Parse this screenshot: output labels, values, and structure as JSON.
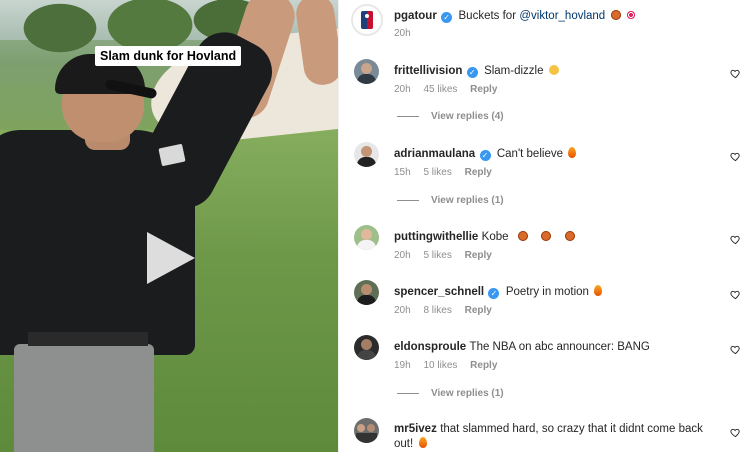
{
  "video": {
    "caption": "Slam dunk for Hovland"
  },
  "post": {
    "username": "pgatour",
    "caption_prefix": "Buckets for",
    "mention": "@viktor_hovland",
    "emojis": [
      "basketball",
      "bullseye"
    ],
    "time": "20h"
  },
  "comments": [
    {
      "username": "frittellivision",
      "verified": true,
      "text": "Slam-dizzle",
      "emojis": [
        "laughing-face"
      ],
      "time": "20h",
      "likes": "45 likes",
      "reply": "Reply",
      "view_replies": "View replies (4)"
    },
    {
      "username": "adrianmaulana",
      "verified": true,
      "text": "Can't believe",
      "emojis": [
        "fire"
      ],
      "time": "15h",
      "likes": "5 likes",
      "reply": "Reply",
      "view_replies": "View replies (1)"
    },
    {
      "username": "puttingwithellie",
      "verified": false,
      "text": "Kobe",
      "emojis": [
        "basketball",
        "basketball",
        "basketball"
      ],
      "time": "20h",
      "likes": "5 likes",
      "reply": "Reply",
      "view_replies": ""
    },
    {
      "username": "spencer_schnell",
      "verified": true,
      "text": "Poetry in motion",
      "emojis": [
        "fire"
      ],
      "time": "20h",
      "likes": "8 likes",
      "reply": "Reply",
      "view_replies": ""
    },
    {
      "username": "eldonsproule",
      "verified": false,
      "text": "The NBA on abc announcer: BANG",
      "emojis": [],
      "time": "19h",
      "likes": "10 likes",
      "reply": "Reply",
      "view_replies": "View replies (1)"
    },
    {
      "username": "mr5ivez",
      "verified": false,
      "text": "that slammed hard, so crazy that it didnt come back",
      "text2": "out!",
      "emojis": [
        "fire"
      ],
      "time": "",
      "likes": "",
      "reply": "",
      "view_replies": ""
    }
  ],
  "icons": {
    "verified": "verified-badge-icon",
    "like": "heart-icon",
    "play": "play-icon"
  },
  "colors": {
    "verified_blue": "#3897f0",
    "mention": "#00376b",
    "muted": "#8e8e8e"
  }
}
